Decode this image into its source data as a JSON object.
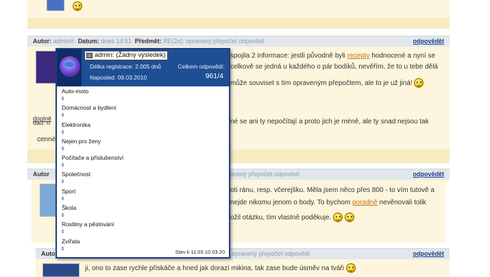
{
  "posts": [
    {
      "author_label": "Autor:",
      "author": "admin®",
      "date_label": "Datum:",
      "date": "dnes 14:51",
      "subject_label": "Předmět:",
      "subject": "RE(2x): opravený přepočet odpovědí",
      "reply": "odpovědět",
      "lines": [
        "spojila 2 informace: jestli původně byli ",
        "celkově se jedná u každého o pár bodíků, nevěřím, že to u tebe dělá",
        "může souviset s tím opraveným přepočtem, ale to je už jiná!",
        "né se ani ty nepočítají a proto jich je méně, ale ty snad nejsou tak"
      ],
      "link_word": "recepty",
      "line0_tail": " hodnocené a nyní se",
      "left_fragment_a": "doplně",
      "left_fragment_b": "dad. o",
      "left_fragment_c": "cenné"
    },
    {
      "author_label": "Autor",
      "subject": "avený přepočet odpovědí",
      "reply": "odpovědět",
      "lines": [
        "oti ránu, resp. včerejšku. Měla jsem něco přes 800 - to vím tutově a",
        "nejde nikomu jenom o body. To bychom ",
        "ožil otázku, tím vlastně poděkuje."
      ],
      "link_word": "poradně",
      "line1_tail": " nevěnovali tolik"
    },
    {
      "author_label": "Autor",
      "subject": "opravený přepočet odpovědí",
      "reply": "odpovědět",
      "lines": [
        "ji, ono to zase rychle přiskáče a hned jak dorazí mikina, tak zase bude úsměv na tváři"
      ]
    }
  ],
  "popup": {
    "username": "admin: (Žádný výsledek)",
    "reg_label": "Délka registrace:",
    "reg_value": "2.005 dnů",
    "last_label": "Naposled:",
    "last_value": "09.03.2010",
    "total_label": "Celkem odpovědí:",
    "total_value": "961/4",
    "categories": [
      "Auto-moto",
      "Domácnost a bydlení",
      "Elektronika",
      "Nejen pro ženy",
      "Počítače a příslušenství",
      "Společnost",
      "Sport",
      "Škola",
      "Rostliny a pěstování",
      "Zvířata"
    ],
    "footer": "Stav k 11.03.10 03:20"
  },
  "colors": {
    "header_bg": "#e3e6ea",
    "post_bg": "#fdf5dd",
    "popup_head": "#1e4f93",
    "link": "#c0741a"
  }
}
